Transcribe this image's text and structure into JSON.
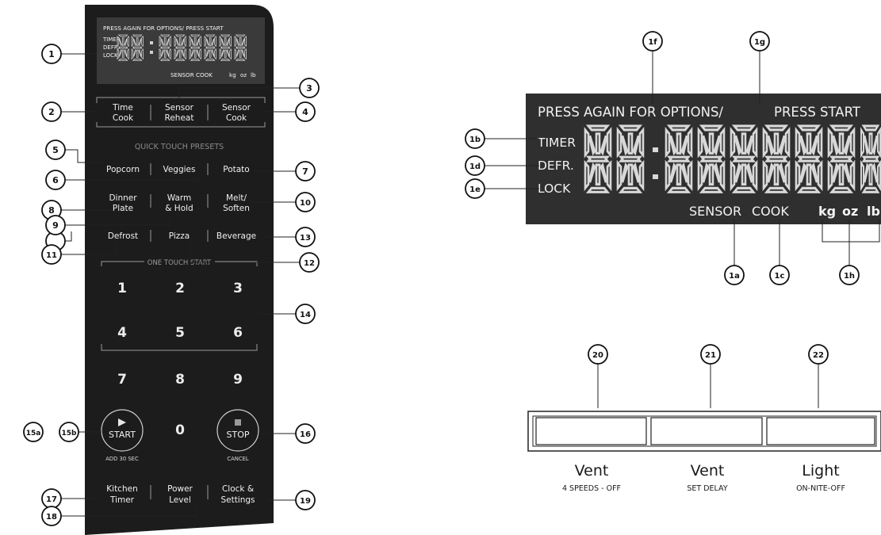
{
  "display": {
    "top_line": "PRESS AGAIN FOR OPTIONS/  PRESS START",
    "timer": "TIMER",
    "defr": "DEFR.",
    "lock": "LOCK",
    "segments": "88:88888",
    "sensor_cook": "SENSOR COOK",
    "units": [
      "kg",
      "oz",
      "lb"
    ]
  },
  "big_display": {
    "top_line_left": "PRESS AGAIN FOR OPTIONS/",
    "top_line_right": "PRESS START",
    "timer": "TIMER",
    "defr": "DEFR.",
    "lock": "LOCK",
    "sensor": "SENSOR",
    "cook": "COOK",
    "units": [
      "kg",
      "oz",
      "lb"
    ]
  },
  "buttons": {
    "time_cook": [
      "Time",
      "Cook"
    ],
    "sensor_reheat": [
      "Sensor",
      "Reheat"
    ],
    "sensor_cook": [
      "Sensor",
      "Cook"
    ],
    "presets_heading": "QUICK TOUCH PRESETS",
    "popcorn": "Popcorn",
    "veggies": "Veggies",
    "potato": "Potato",
    "dinner_plate": [
      "Dinner",
      "Plate"
    ],
    "warm_hold": [
      "Warm",
      "& Hold"
    ],
    "melt_soften": [
      "Melt/",
      "Soften"
    ],
    "defrost": "Defrost",
    "pizza": "Pizza",
    "beverage": "Beverage",
    "one_touch_heading": "ONE TOUCH START",
    "digits": [
      "1",
      "2",
      "3",
      "4",
      "5",
      "6",
      "7",
      "8",
      "9",
      "0"
    ],
    "start": "START",
    "start_sub": "ADD 30 SEC",
    "stop": "STOP",
    "stop_sub": "CANCEL",
    "kitchen_timer": [
      "Kitchen",
      "Timer"
    ],
    "power_level": [
      "Power",
      "Level"
    ],
    "clock_settings": [
      "Clock &",
      "Settings"
    ]
  },
  "callouts_left": [
    "1",
    "2",
    "3",
    "4",
    "5",
    "6",
    "7",
    "8",
    "9",
    "10",
    "11",
    "12",
    "13",
    "14",
    "15a",
    "15b",
    "16",
    "17",
    "18",
    "19"
  ],
  "callouts_display": [
    "1f",
    "1g",
    "1b",
    "1d",
    "1e",
    "1a",
    "1c",
    "1h"
  ],
  "callouts_vent": [
    "20",
    "21",
    "22"
  ],
  "vent_panel": {
    "vent1_title": "Vent",
    "vent1_sub": "4 SPEEDS - OFF",
    "vent2_title": "Vent",
    "vent2_sub": "SET DELAY",
    "light_title": "Light",
    "light_sub": "ON-NITE-OFF"
  }
}
